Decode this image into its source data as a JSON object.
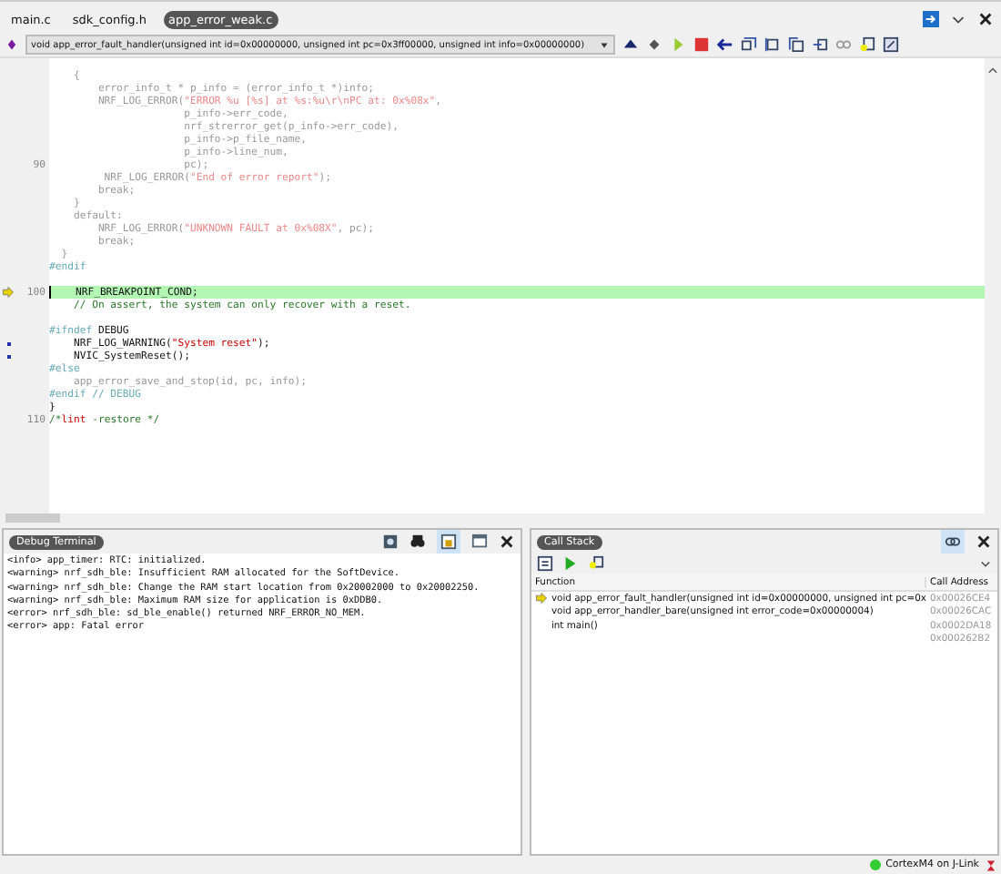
{
  "tabs": [
    {
      "label": "main.c",
      "selected": false
    },
    {
      "label": "sdk_config.h",
      "selected": false
    },
    {
      "label": "app_error_weak.c",
      "selected": true
    }
  ],
  "function_selector": {
    "value": "void app_error_fault_handler(unsigned int id=0x00000000, unsigned int pc=0x3ff00000, unsigned int info=0x00000000)"
  },
  "code_lines": [
    {
      "segments": [
        {
          "kind": "dim",
          "text": "    {"
        }
      ]
    },
    {
      "segments": [
        {
          "kind": "dim",
          "text": "        error_info_t * p_info = (error_info_t *)info;"
        }
      ]
    },
    {
      "segments": [
        {
          "kind": "dim",
          "text": "        NRF_LOG_ERROR("
        },
        {
          "kind": "dimstring",
          "text": "\"ERROR %u [%s] at %s:%u\\r\\nPC at: 0x%08x\""
        },
        {
          "kind": "dim",
          "text": ","
        }
      ]
    },
    {
      "segments": [
        {
          "kind": "dim",
          "text": "                      p_info->err_code,"
        }
      ]
    },
    {
      "segments": [
        {
          "kind": "dim",
          "text": "                      nrf_strerror_get(p_info->err_code),"
        }
      ]
    },
    {
      "segments": [
        {
          "kind": "dim",
          "text": "                      p_info->p_file_name,"
        }
      ]
    },
    {
      "segments": [
        {
          "kind": "dim",
          "text": "                      p_info->line_num,"
        }
      ]
    },
    {
      "number": "90",
      "segments": [
        {
          "kind": "dim",
          "text": "                      pc);"
        }
      ]
    },
    {
      "segments": [
        {
          "kind": "dim",
          "text": "         NRF_LOG_ERROR("
        },
        {
          "kind": "dimstring",
          "text": "\"End of error report\""
        },
        {
          "kind": "dim",
          "text": ");"
        }
      ]
    },
    {
      "segments": [
        {
          "kind": "dim",
          "text": "        break;"
        }
      ]
    },
    {
      "segments": [
        {
          "kind": "dim",
          "text": "    }"
        }
      ]
    },
    {
      "segments": [
        {
          "kind": "dim",
          "text": "    default:"
        }
      ]
    },
    {
      "segments": [
        {
          "kind": "dim",
          "text": "        NRF_LOG_ERROR("
        },
        {
          "kind": "dimstring",
          "text": "\"UNKNOWN FAULT at 0x%08X\""
        },
        {
          "kind": "dim",
          "text": ", pc);"
        }
      ]
    },
    {
      "segments": [
        {
          "kind": "dim",
          "text": "        break;"
        }
      ]
    },
    {
      "segments": [
        {
          "kind": "dim",
          "text": "  }"
        }
      ]
    },
    {
      "gap_after": true,
      "segments": [
        {
          "kind": "preproc",
          "text": "#endif"
        }
      ]
    },
    {
      "number": "100",
      "current": true,
      "highlight": true,
      "segments": [
        {
          "kind": "code",
          "text": "    NRF_BREAKPOINT_COND;"
        }
      ]
    },
    {
      "gap_after": true,
      "segments": [
        {
          "kind": "comment",
          "text": "    // On assert, the system can only recover with a reset."
        }
      ]
    },
    {
      "segments": [
        {
          "kind": "preproc",
          "text": "#ifndef"
        },
        {
          "kind": "code",
          "text": " DEBUG"
        }
      ]
    },
    {
      "breakpoint": true,
      "segments": [
        {
          "kind": "code",
          "text": "    NRF_LOG_WARNING("
        },
        {
          "kind": "string",
          "text": "\"System reset\""
        },
        {
          "kind": "code",
          "text": ");"
        }
      ]
    },
    {
      "breakpoint": true,
      "segments": [
        {
          "kind": "code",
          "text": "    NVIC_SystemReset();"
        }
      ]
    },
    {
      "segments": [
        {
          "kind": "preproc",
          "text": "#else"
        }
      ]
    },
    {
      "segments": [
        {
          "kind": "dim",
          "text": "    app_error_save_and_stop(id, pc, info);"
        }
      ]
    },
    {
      "segments": [
        {
          "kind": "preproc",
          "text": "#endif // DEBUG"
        }
      ]
    },
    {
      "segments": [
        {
          "kind": "code",
          "text": "}"
        }
      ]
    },
    {
      "number": "110",
      "segments": [
        {
          "kind": "comment",
          "text": "/*"
        },
        {
          "kind": "string",
          "text": "lint"
        },
        {
          "kind": "comment",
          "text": " -restore */"
        }
      ]
    }
  ],
  "debug_terminal": {
    "title": "Debug Terminal",
    "lines": [
      "<info> app_timer: RTC: initialized.",
      "<warning> nrf_sdh_ble: Insufficient RAM allocated for the SoftDevice.",
      "<warning> nrf_sdh_ble: Change the RAM start location from 0x20002000 to 0x20002250.",
      "<warning> nrf_sdh_ble: Maximum RAM size for application is 0xDDB0.",
      "<error> nrf_sdh_ble: sd_ble_enable() returned NRF_ERROR_NO_MEM.",
      "<error> app: Fatal error"
    ]
  },
  "call_stack": {
    "title": "Call Stack",
    "columns": [
      "Function",
      "Call Address"
    ],
    "rows": [
      {
        "current": true,
        "function": "void app_error_fault_handler(unsigned int id=0x00000000, unsigned int pc=0x",
        "address": "0x00026CE4"
      },
      {
        "current": false,
        "function": "void app_error_handler_bare(unsigned int error_code=0x00000004)",
        "address": "0x00026CAC"
      },
      {
        "current": false,
        "function": "int main()",
        "address": "0x0002DA18"
      },
      {
        "current": false,
        "address": "0x000262B2"
      }
    ]
  },
  "status_bar": {
    "target": "CortexM4 on J-Link",
    "connected": true
  }
}
